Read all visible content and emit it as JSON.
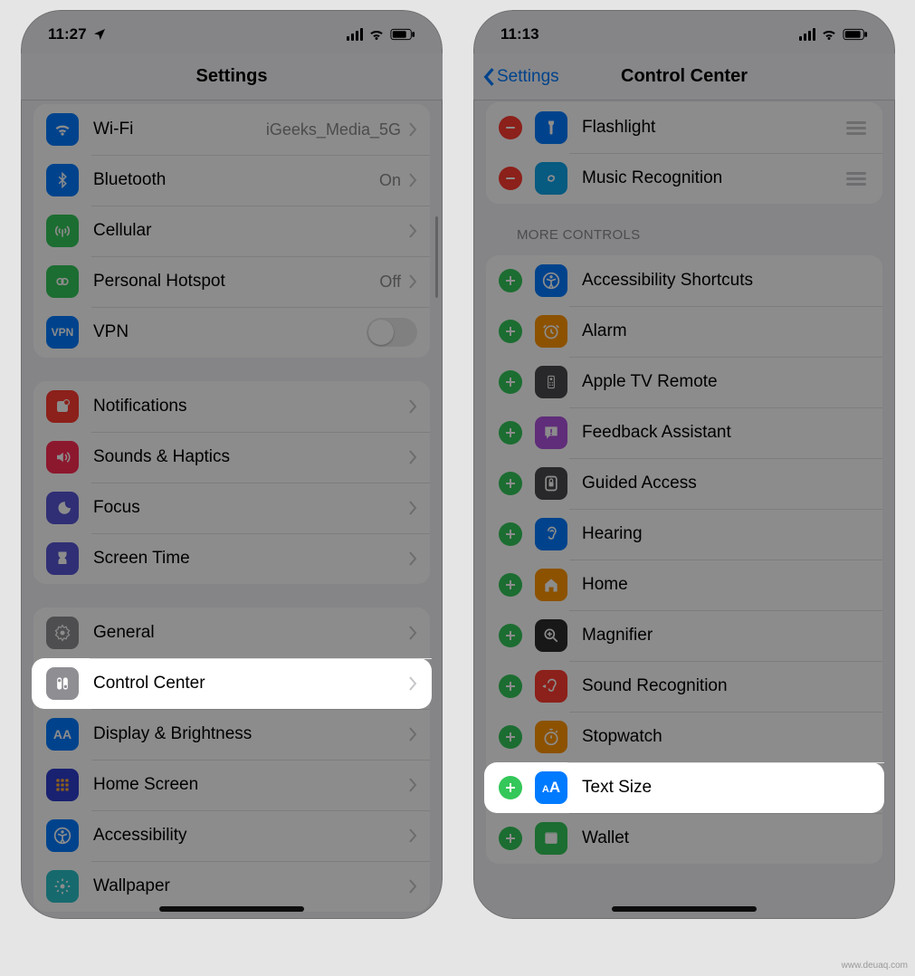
{
  "left": {
    "status": {
      "time": "11:27",
      "location_arrow": true
    },
    "title": "Settings",
    "groups": [
      {
        "rows": [
          {
            "icon": "wifi",
            "color": "#007aff",
            "label": "Wi-Fi",
            "value": "iGeeks_Media_5G",
            "accessory": "chevron"
          },
          {
            "icon": "bt",
            "color": "#007aff",
            "label": "Bluetooth",
            "value": "On",
            "accessory": "chevron"
          },
          {
            "icon": "cell",
            "color": "#34c759",
            "label": "Cellular",
            "value": "",
            "accessory": "chevron"
          },
          {
            "icon": "hotspot",
            "color": "#34c759",
            "label": "Personal Hotspot",
            "value": "Off",
            "accessory": "chevron"
          },
          {
            "icon": "vpn",
            "color": "#007aff",
            "label": "VPN",
            "value": "",
            "accessory": "toggle-off"
          }
        ]
      },
      {
        "rows": [
          {
            "icon": "notif",
            "color": "#ff3b30",
            "label": "Notifications",
            "accessory": "chevron"
          },
          {
            "icon": "sound",
            "color": "#ff2d55",
            "label": "Sounds & Haptics",
            "accessory": "chevron"
          },
          {
            "icon": "focus",
            "color": "#5856d6",
            "label": "Focus",
            "accessory": "chevron"
          },
          {
            "icon": "time",
            "color": "#5856d6",
            "label": "Screen Time",
            "accessory": "chevron"
          }
        ]
      },
      {
        "rows": [
          {
            "icon": "general",
            "color": "#8e8e93",
            "label": "General",
            "accessory": "chevron"
          },
          {
            "icon": "cc",
            "color": "#8e8e93",
            "label": "Control Center",
            "accessory": "chevron",
            "highlight": true
          },
          {
            "icon": "display",
            "color": "#007aff",
            "label": "Display & Brightness",
            "accessory": "chevron"
          },
          {
            "icon": "home",
            "color": "#2f3cce",
            "label": "Home Screen",
            "accessory": "chevron"
          },
          {
            "icon": "access",
            "color": "#007aff",
            "label": "Accessibility",
            "accessory": "chevron"
          },
          {
            "icon": "wall",
            "color": "#29c2c8",
            "label": "Wallpaper",
            "accessory": "chevron"
          }
        ]
      }
    ]
  },
  "right": {
    "status": {
      "time": "11:13"
    },
    "back_label": "Settings",
    "title": "Control Center",
    "included": [
      {
        "icon": "flash",
        "color": "#007aff",
        "label": "Flashlight"
      },
      {
        "icon": "shazam",
        "color": "#0ea5e9",
        "label": "Music Recognition"
      }
    ],
    "more_header": "MORE CONTROLS",
    "more": [
      {
        "icon": "access2",
        "color": "#007aff",
        "label": "Accessibility Shortcuts"
      },
      {
        "icon": "alarm",
        "color": "#ff9500",
        "label": "Alarm"
      },
      {
        "icon": "tvrem",
        "color": "#4a4a4d",
        "label": "Apple TV Remote"
      },
      {
        "icon": "feedbk",
        "color": "#af52de",
        "label": "Feedback Assistant"
      },
      {
        "icon": "guided",
        "color": "#4a4a4d",
        "label": "Guided Access"
      },
      {
        "icon": "hear",
        "color": "#007aff",
        "label": "Hearing"
      },
      {
        "icon": "homekit",
        "color": "#ff9500",
        "label": "Home"
      },
      {
        "icon": "mag",
        "color": "#2c2c2e",
        "label": "Magnifier"
      },
      {
        "icon": "srec",
        "color": "#ff3b30",
        "label": "Sound Recognition"
      },
      {
        "icon": "stop",
        "color": "#ff9500",
        "label": "Stopwatch"
      },
      {
        "icon": "text",
        "color": "#007aff",
        "label": "Text Size",
        "highlight": true
      },
      {
        "icon": "wallet",
        "color": "#34c759",
        "label": "Wallet"
      }
    ]
  },
  "watermark": "www.deuaq.com"
}
